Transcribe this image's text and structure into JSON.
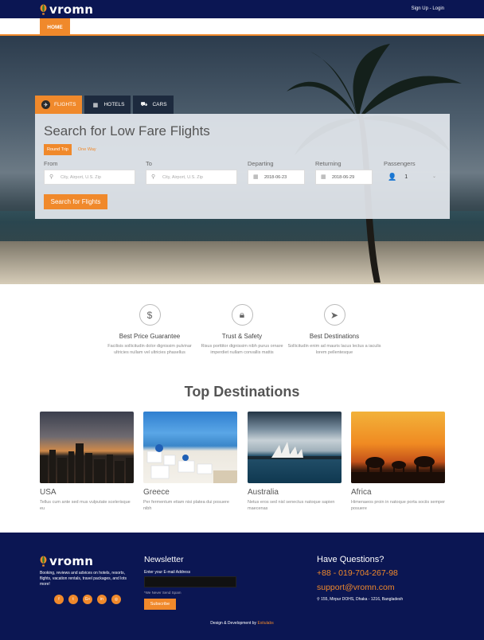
{
  "header": {
    "logo_text": "vromn",
    "signup": "Sign Up",
    "separator": " - ",
    "login": "Login"
  },
  "nav": {
    "home": "HOME"
  },
  "search": {
    "tabs": [
      {
        "label": "FLIGHTS",
        "icon": "plane-icon"
      },
      {
        "label": "HOTELS",
        "icon": "building-icon"
      },
      {
        "label": "CARS",
        "icon": "car-icon"
      }
    ],
    "title": "Search for Low Fare Flights",
    "trip_round": "Round Trip",
    "trip_oneway": "One Way",
    "from_label": "From",
    "from_placeholder": "City, Airport, U.S. Zip",
    "to_label": "To",
    "to_placeholder": "City, Airport, U.S. Zip",
    "departing_label": "Departing",
    "departing_value": "2018-06-23",
    "returning_label": "Returning",
    "returning_value": "2018-06-29",
    "passengers_label": "Passengers",
    "passengers_value": "1",
    "button": "Search for Flights"
  },
  "features": [
    {
      "icon": "dollar-icon",
      "title": "Best Price Guarantee",
      "text": "Facilisis sollicitudin dolor dignissim pulvinar ultricies nullam vel ultricies phasellus"
    },
    {
      "icon": "lock-icon",
      "title": "Trust & Safety",
      "text": "Risus porttitor dignissim nibh purus ornare imperdiet nullam convallis mattis"
    },
    {
      "icon": "paper-plane-icon",
      "title": "Best Destinations",
      "text": "Sollicitudin enim ad mauris lacus lectus a iaculis lorem pellentesque"
    }
  ],
  "destinations": {
    "heading": "Top Destinations",
    "items": [
      {
        "name": "USA",
        "text": "Tellus cum ante sed mus vulputate scelerisque eu"
      },
      {
        "name": "Greece",
        "text": "Per fermentum etiam nisi platea dui posuere nibh"
      },
      {
        "name": "Australia",
        "text": "Netus eros sed nisl senectus natoque sapien maecenas"
      },
      {
        "name": "Africa",
        "text": "Himenaeos proin in natoque porta sociis semper posuere"
      }
    ]
  },
  "footer": {
    "logo_text": "vromn",
    "about": "Booking, reviews and advices on hotels, resorts, flights, vacation rentals, travel packages, and lots more!",
    "social": [
      "f",
      "t",
      "G+",
      "in",
      "◎"
    ],
    "newsletter_title": "Newsletter",
    "email_label": "Enter your E-mail Address",
    "spam_note": "*We Never Send Spam",
    "subscribe": "Subscribe",
    "questions_title": "Have Questions?",
    "phone": "+88 - 019-704-267-98",
    "email": "support@vromn.com",
    "address": "155, Mirpur DOHS, Dhaka - 1216, Bangladesh",
    "credit_prefix": "Design & Development by ",
    "credit_brand": "Exitulabs"
  },
  "colors": {
    "navy": "#0b1653",
    "accent": "#f0892b"
  }
}
